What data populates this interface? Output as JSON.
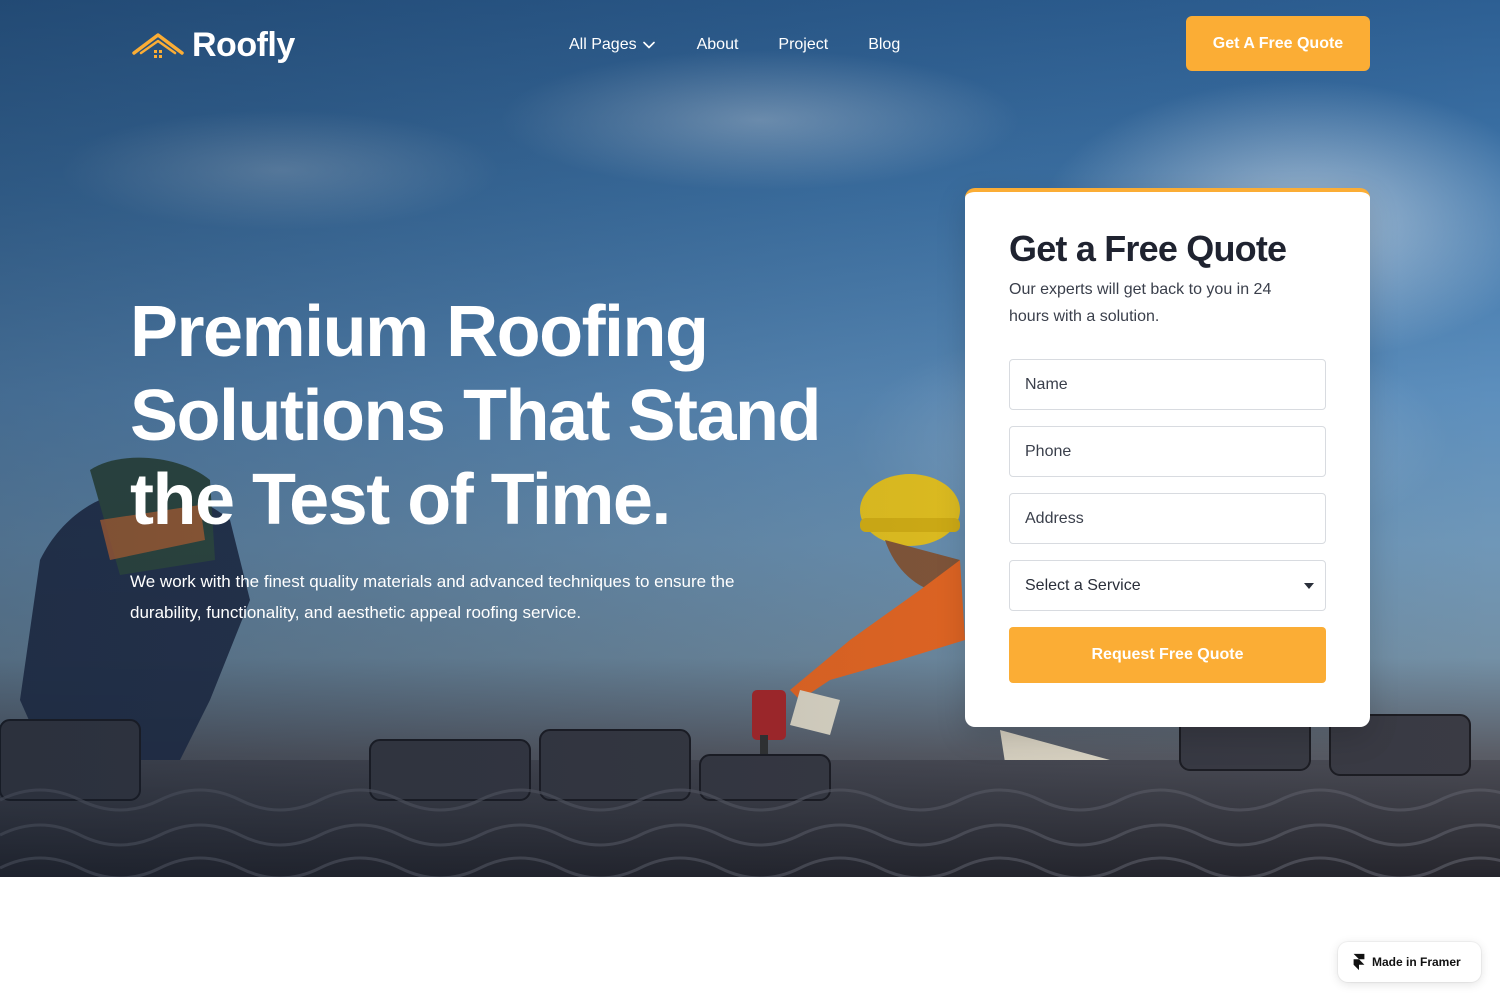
{
  "brand": {
    "name": "Roofly",
    "accent": "#fbad35"
  },
  "nav": {
    "items": [
      {
        "label": "All Pages",
        "has_dropdown": true
      },
      {
        "label": "About"
      },
      {
        "label": "Project"
      },
      {
        "label": "Blog"
      }
    ],
    "cta_label": "Get A Free Quote"
  },
  "hero": {
    "title": "Premium Roofing Solutions That Stand the Test of Time.",
    "subtitle": "We work with the finest quality materials and advanced techniques to ensure the durability, functionality, and aesthetic appeal roofing service."
  },
  "quote_form": {
    "title": "Get a Free Quote",
    "subtitle": "Our experts will get back to you in 24 hours with a solution.",
    "name_placeholder": "Name",
    "phone_placeholder": "Phone",
    "address_placeholder": "Address",
    "service_selected": "Select a Service",
    "submit_label": "Request Free Quote"
  },
  "badge": {
    "label": "Made in Framer",
    "icon": "framer-icon"
  }
}
